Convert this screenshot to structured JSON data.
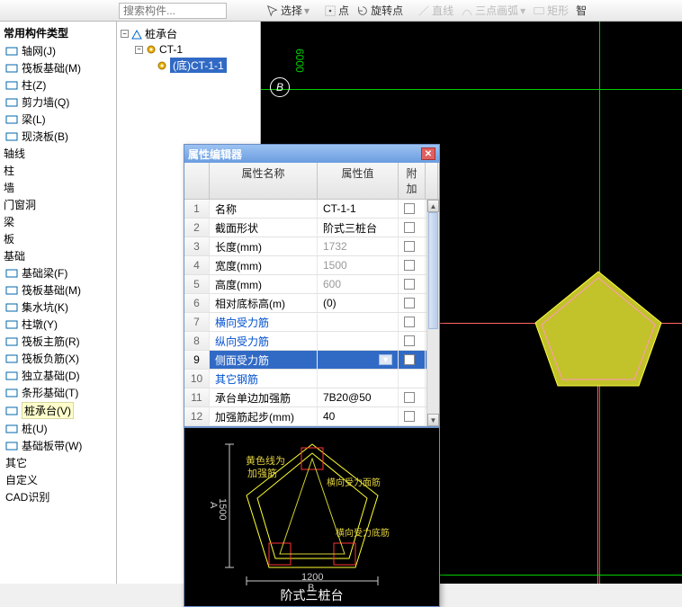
{
  "toolbar1": {
    "search_placeholder": "搜索构件..."
  },
  "toolbar2": {
    "select": "选择",
    "point": "点",
    "rotate_point": "旋转点",
    "line": "直线",
    "arc3": "三点画弧",
    "rect": "矩形",
    "smart": "智"
  },
  "left_tree": {
    "heading": "常用构件类型",
    "items": [
      {
        "label": "轴网(J)",
        "icon": "grid"
      },
      {
        "label": "筏板基础(M)",
        "icon": "slab"
      },
      {
        "label": "柱(Z)",
        "icon": "col"
      },
      {
        "label": "剪力墙(Q)",
        "icon": "wall"
      },
      {
        "label": "梁(L)",
        "icon": "beam"
      },
      {
        "label": "现浇板(B)",
        "icon": "slab2"
      }
    ],
    "groups": [
      "轴线",
      "柱",
      "墙",
      "门窗洞",
      "梁",
      "板",
      "基础"
    ],
    "foundation": [
      {
        "label": "基础梁(F)"
      },
      {
        "label": "筏板基础(M)"
      },
      {
        "label": "集水坑(K)"
      },
      {
        "label": "柱墩(Y)"
      },
      {
        "label": "筏板主筋(R)"
      },
      {
        "label": "筏板负筋(X)"
      },
      {
        "label": "独立基础(D)"
      },
      {
        "label": "条形基础(T)"
      },
      {
        "label": "桩承台(V)",
        "selected": true
      },
      {
        "label": "桩(U)"
      },
      {
        "label": "基础板带(W)"
      }
    ],
    "footer": [
      "其它",
      "自定义",
      "CAD识别"
    ]
  },
  "mid_tree": {
    "root": "桩承台",
    "child": "CT-1",
    "leaf": "(底)CT-1-1"
  },
  "dialog": {
    "title": "属性编辑器",
    "headers": {
      "name": "属性名称",
      "value": "属性值",
      "extra": "附加"
    },
    "rows": [
      {
        "idx": 1,
        "name": "名称",
        "val": "CT-1-1",
        "link": false,
        "chk": true
      },
      {
        "idx": 2,
        "name": "截面形状",
        "val": "阶式三桩台",
        "link": false,
        "chk": true
      },
      {
        "idx": 3,
        "name": "长度(mm)",
        "val": "1732",
        "link": false,
        "muted": true,
        "chk": true
      },
      {
        "idx": 4,
        "name": "宽度(mm)",
        "val": "1500",
        "link": false,
        "muted": true,
        "chk": true
      },
      {
        "idx": 5,
        "name": "高度(mm)",
        "val": "600",
        "link": false,
        "muted": true,
        "chk": true
      },
      {
        "idx": 6,
        "name": "相对底标高(m)",
        "val": "(0)",
        "link": false,
        "chk": true
      },
      {
        "idx": 7,
        "name": "横向受力筋",
        "val": "",
        "link": true,
        "chk": true
      },
      {
        "idx": 8,
        "name": "纵向受力筋",
        "val": "",
        "link": true,
        "chk": true
      },
      {
        "idx": 9,
        "name": "侧面受力筋",
        "val": "",
        "link": true,
        "selected": true,
        "chk": true,
        "dd": true
      },
      {
        "idx": 10,
        "name": "其它钢筋",
        "val": "",
        "link": true,
        "chk": false
      },
      {
        "idx": 11,
        "name": "承台单边加强筋",
        "val": "7B20@50",
        "link": false,
        "chk": true
      },
      {
        "idx": 12,
        "name": "加强筋起步(mm)",
        "val": "40",
        "link": false,
        "chk": true
      }
    ],
    "graphic": {
      "h_dim": "1200",
      "v_dim": "1500",
      "h_letter": "B",
      "v_letter": "A",
      "yellow_label1": "黄色线为",
      "yellow_label2": "加强筋",
      "lbl_side_top": "横向受力面筋",
      "lbl_side_bot": "横向受力底筋",
      "title": "阶式三桩台"
    }
  },
  "canvas": {
    "dim": "6000",
    "axis_label": "B"
  }
}
